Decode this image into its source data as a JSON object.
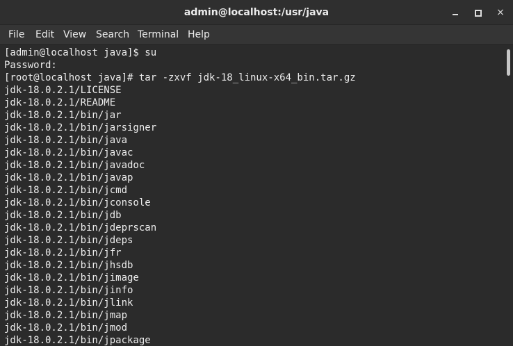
{
  "window": {
    "title": "admin@localhost:/usr/java",
    "controls": {
      "minimize_icon": "minimize-icon",
      "maximize_icon": "maximize-icon",
      "close_icon": "close-icon",
      "close_glyph": "×"
    }
  },
  "menu": {
    "items": [
      "File",
      "Edit",
      "View",
      "Search",
      "Terminal",
      "Help"
    ]
  },
  "terminal": {
    "lines": [
      "[admin@localhost java]$ su",
      "Password:",
      "[root@localhost java]# tar -zxvf jdk-18_linux-x64_bin.tar.gz",
      "jdk-18.0.2.1/LICENSE",
      "jdk-18.0.2.1/README",
      "jdk-18.0.2.1/bin/jar",
      "jdk-18.0.2.1/bin/jarsigner",
      "jdk-18.0.2.1/bin/java",
      "jdk-18.0.2.1/bin/javac",
      "jdk-18.0.2.1/bin/javadoc",
      "jdk-18.0.2.1/bin/javap",
      "jdk-18.0.2.1/bin/jcmd",
      "jdk-18.0.2.1/bin/jconsole",
      "jdk-18.0.2.1/bin/jdb",
      "jdk-18.0.2.1/bin/jdeprscan",
      "jdk-18.0.2.1/bin/jdeps",
      "jdk-18.0.2.1/bin/jfr",
      "jdk-18.0.2.1/bin/jhsdb",
      "jdk-18.0.2.1/bin/jimage",
      "jdk-18.0.2.1/bin/jinfo",
      "jdk-18.0.2.1/bin/jlink",
      "jdk-18.0.2.1/bin/jmap",
      "jdk-18.0.2.1/bin/jmod",
      "jdk-18.0.2.1/bin/jpackage"
    ]
  },
  "colors": {
    "background": "#2b2b2b",
    "text": "#ececec",
    "titlebar": "#2f2f2f",
    "menubar": "#353535"
  }
}
